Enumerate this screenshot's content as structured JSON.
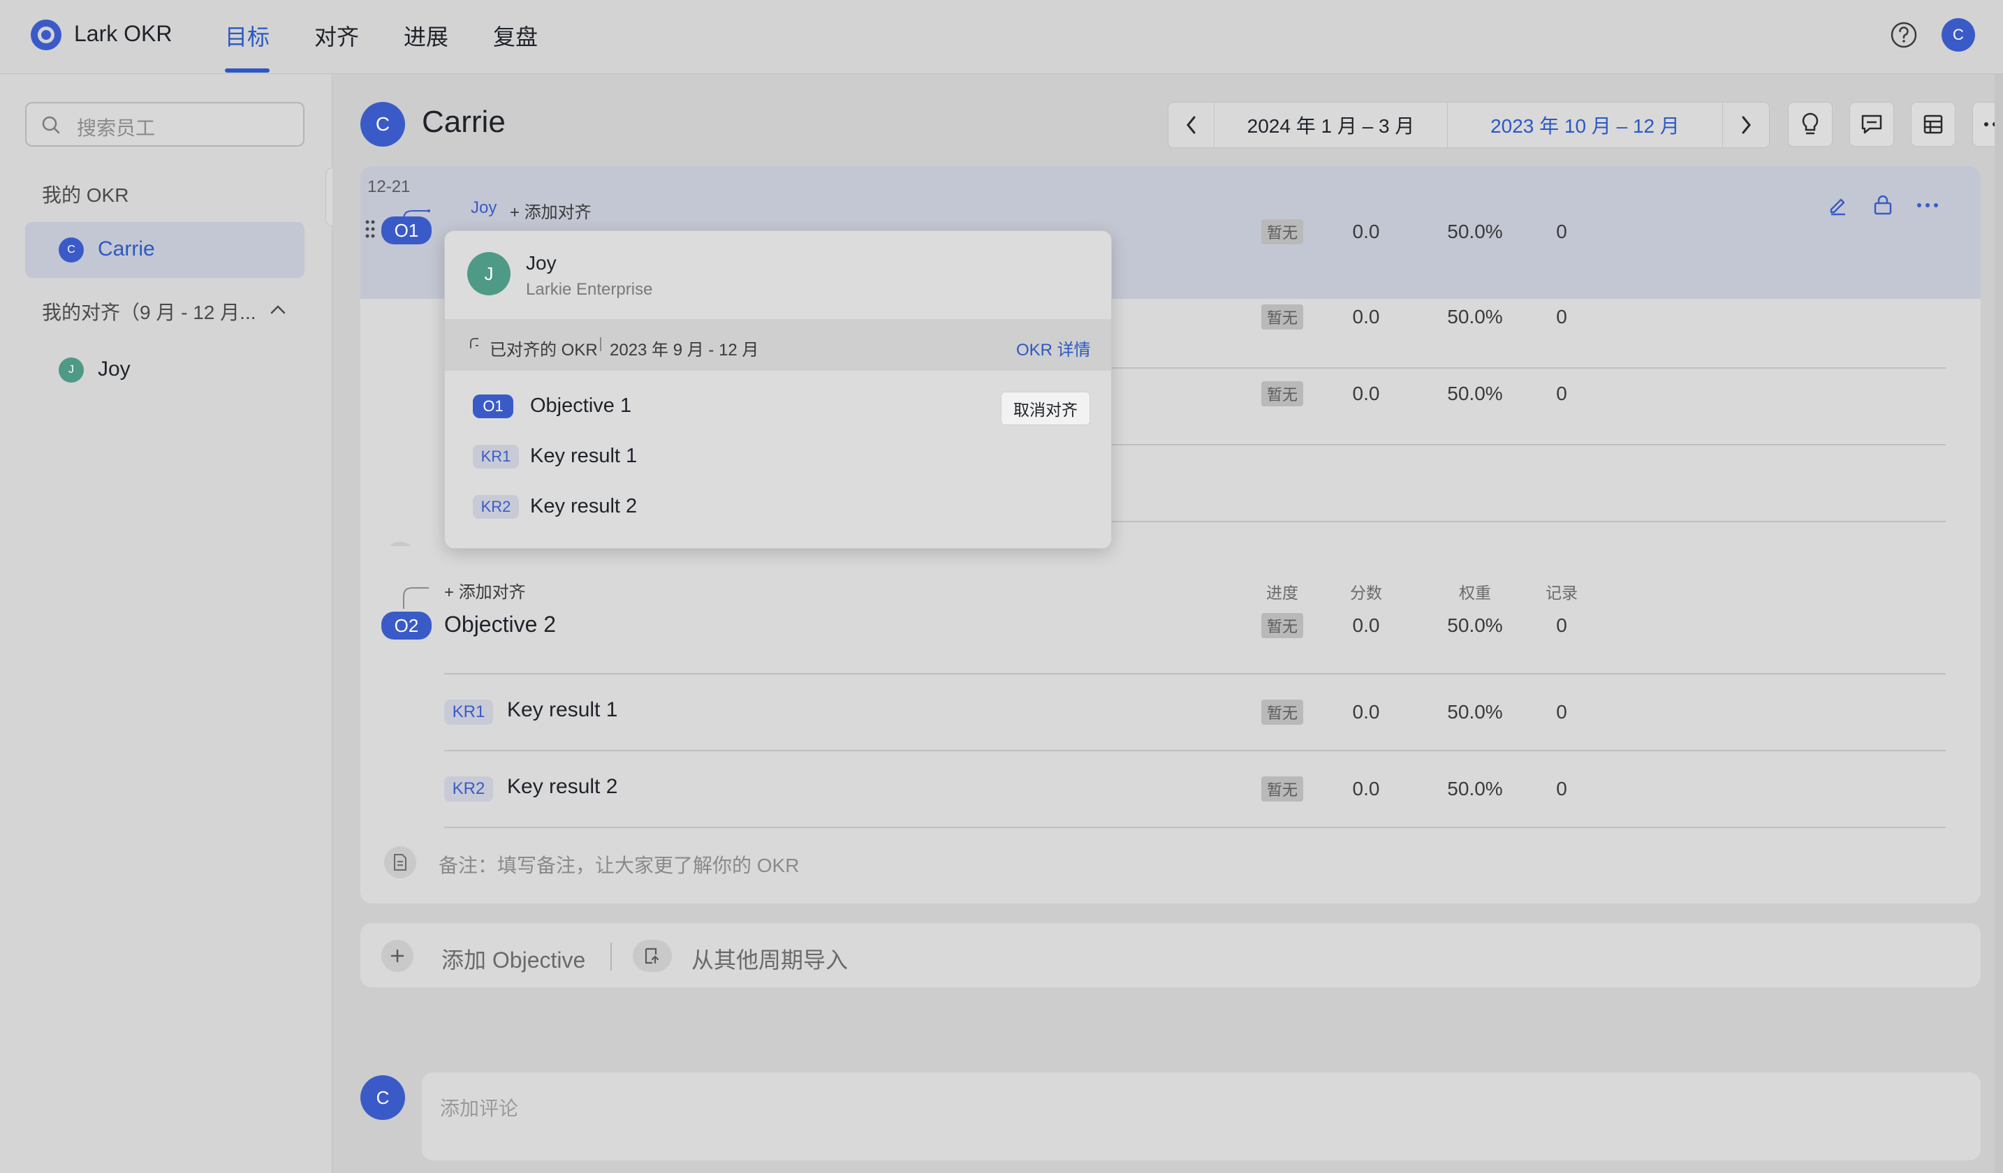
{
  "app": {
    "name": "Lark OKR"
  },
  "nav": {
    "tabs": [
      "目标",
      "对齐",
      "进展",
      "复盘"
    ],
    "active": "目标"
  },
  "user": {
    "initial": "C"
  },
  "sidebar": {
    "search_placeholder": "搜索员工",
    "my_okr_label": "我的 OKR",
    "my_okr_user": {
      "initial": "C",
      "name": "Carrie"
    },
    "my_align_label": "我的对齐（9 月 - 12 月...",
    "align_users": [
      {
        "initial": "J",
        "name": "Joy"
      }
    ]
  },
  "header": {
    "initial": "C",
    "name": "Carrie",
    "period_current": "2024 年 1 月 – 3 月",
    "period_selected": "2023 年 10 月 – 12 月"
  },
  "objective1": {
    "date_tag": "12-21",
    "aligned_name": "Joy",
    "add_align": "添加对齐",
    "badge": "O1",
    "rows": [
      {
        "status": "暂无",
        "score": "0.0",
        "weight": "50.0%",
        "records": "0"
      },
      {
        "status": "暂无",
        "score": "0.0",
        "weight": "50.0%",
        "records": "0"
      },
      {
        "status": "暂无",
        "score": "0.0",
        "weight": "50.0%",
        "records": "0"
      }
    ]
  },
  "popover": {
    "initial": "J",
    "name": "Joy",
    "company": "Larkie Enterprise",
    "aligned_label": "已对齐的 OKR",
    "aligned_period": "2023 年 9 月 - 12 月",
    "details_link": "OKR 详情",
    "items": [
      {
        "badge": "O1",
        "text": "Objective 1"
      },
      {
        "badge": "KR1",
        "text": "Key result 1"
      },
      {
        "badge": "KR2",
        "text": "Key result 2"
      }
    ],
    "unalign_button": "取消对齐"
  },
  "objective2": {
    "add_align": "添加对齐",
    "headers": [
      "进度",
      "分数",
      "权重",
      "记录"
    ],
    "badge": "O2",
    "title": "Objective 2",
    "status": "暂无",
    "score": "0.0",
    "weight": "50.0%",
    "records": "0",
    "krs": [
      {
        "badge": "KR1",
        "title": "Key result 1",
        "status": "暂无",
        "score": "0.0",
        "weight": "50.0%",
        "records": "0"
      },
      {
        "badge": "KR2",
        "title": "Key result 2",
        "status": "暂无",
        "score": "0.0",
        "weight": "50.0%",
        "records": "0"
      }
    ],
    "note_label": "备注：",
    "note_placeholder": "填写备注，让大家更了解你的 OKR"
  },
  "actions": {
    "add_objective": "添加 Objective",
    "import": "从其他周期导入"
  },
  "comment": {
    "initial": "C",
    "placeholder": "添加评论"
  }
}
